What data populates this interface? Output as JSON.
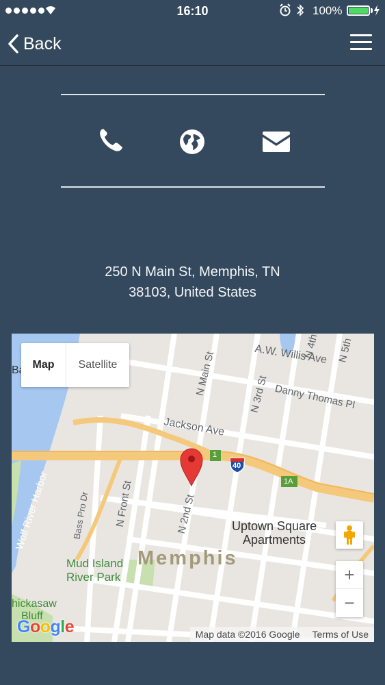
{
  "status_bar": {
    "time": "16:10",
    "battery_percent": "100%",
    "battery_level": 1.0
  },
  "nav": {
    "back_label": "Back"
  },
  "contact": {
    "icons": [
      "phone-icon",
      "globe-icon",
      "mail-icon"
    ]
  },
  "address": {
    "line1": "250 N Main St, Memphis, TN",
    "line2": "38103, United States"
  },
  "map": {
    "type_tabs": [
      "Map",
      "Satellite"
    ],
    "selected_tab": "Map",
    "zoom_in": "+",
    "zoom_out": "−",
    "attribution": "Map data ©2016 Google",
    "terms": "Terms of Use",
    "logo": "Google",
    "labels": {
      "city": "Memphis",
      "park": "Mud Island River Park",
      "park_line1": "Mud Island",
      "park_line2": "River Park",
      "harbor": "Wolf River Harbor",
      "bluff_line1": "hickasaw",
      "bluff_line2": "Bluff",
      "apartments_line1": "Uptown Square",
      "apartments_line2": "Apartments",
      "jackson": "Jackson Ave",
      "willis": "A.W. Willis Ave",
      "danny": "Danny Thomas Pl",
      "main": "N Main St",
      "third": "N 3rd St",
      "second": "N 2nd St",
      "front": "N Front St",
      "basspro": "Bass Pro Dr",
      "fourth": "N 4th",
      "fifth": "N 5th",
      "ba": "Ba",
      "shield_1": "1",
      "shield_1a": "1A",
      "shield_40": "40"
    },
    "colors": {
      "water": "#a6c8f0",
      "highway": "#f5c97b",
      "park": "#c8e0b0",
      "marker": "#e53935"
    }
  }
}
